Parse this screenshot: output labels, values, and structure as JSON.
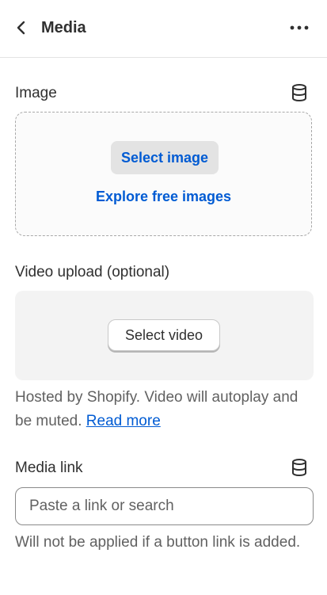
{
  "header": {
    "title": "Media"
  },
  "image_section": {
    "label": "Image",
    "select_button": "Select image",
    "explore_link": "Explore free images"
  },
  "video_section": {
    "label": "Video upload (optional)",
    "select_button": "Select video",
    "help_text": "Hosted by Shopify. Video will autoplay and be muted.",
    "read_more": "Read more"
  },
  "media_link": {
    "label": "Media link",
    "placeholder": "Paste a link or search",
    "value": "",
    "help_text": "Will not be applied if a button link is added."
  },
  "colors": {
    "link_blue": "#005bd3",
    "text": "#303030",
    "muted_text": "#616161"
  }
}
